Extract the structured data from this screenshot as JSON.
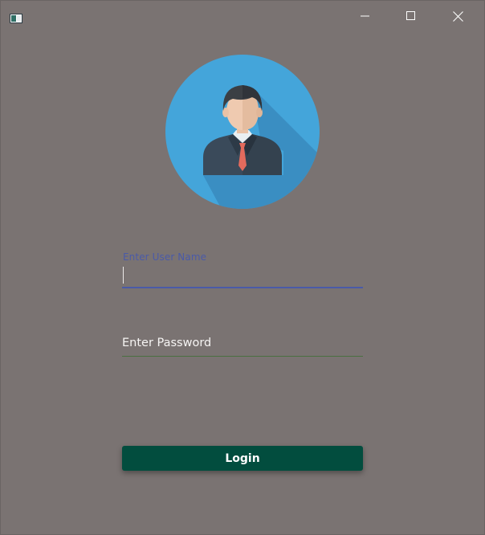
{
  "window": {
    "controls": {
      "minimize_icon": "minimize-icon",
      "maximize_icon": "maximize-icon",
      "close_icon": "close-icon"
    }
  },
  "avatar": {
    "icon": "user-avatar-icon",
    "circle_color": "#44a5da"
  },
  "form": {
    "username": {
      "label": "Enter User Name",
      "value": ""
    },
    "password": {
      "placeholder": "Enter Password",
      "value": ""
    },
    "login_label": "Login"
  },
  "colors": {
    "background": "#7a7372",
    "accent": "#4a5aa8",
    "button": "#024d3e"
  }
}
